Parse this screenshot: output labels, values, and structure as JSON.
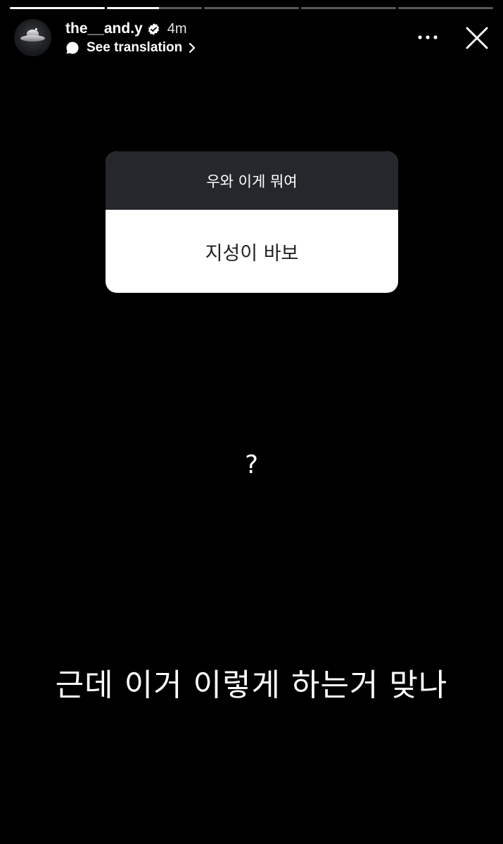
{
  "story": {
    "segments": [
      {
        "progress": 1.0
      },
      {
        "progress": 0.55
      },
      {
        "progress": 0
      },
      {
        "progress": 0
      },
      {
        "progress": 0
      }
    ]
  },
  "header": {
    "username": "the__and.y",
    "time": "4m",
    "translate_label": "See translation",
    "icons": {
      "avatar": "ufo-avatar",
      "verified": "verified-badge-icon",
      "translate": "speech-bubble-icon",
      "chevron": "chevron-right-icon",
      "more": "more-horizontal-icon",
      "close": "close-icon"
    }
  },
  "question_sticker": {
    "question": "우와 이게 뭐여",
    "answer": "지성이 바보"
  },
  "story_text": {
    "question_mark": "?",
    "caption": "근데 이거 이렇게 하는거 맞나"
  },
  "colors": {
    "background": "#000000",
    "sticker_header": "#25272c",
    "sticker_body": "#ffffff"
  }
}
